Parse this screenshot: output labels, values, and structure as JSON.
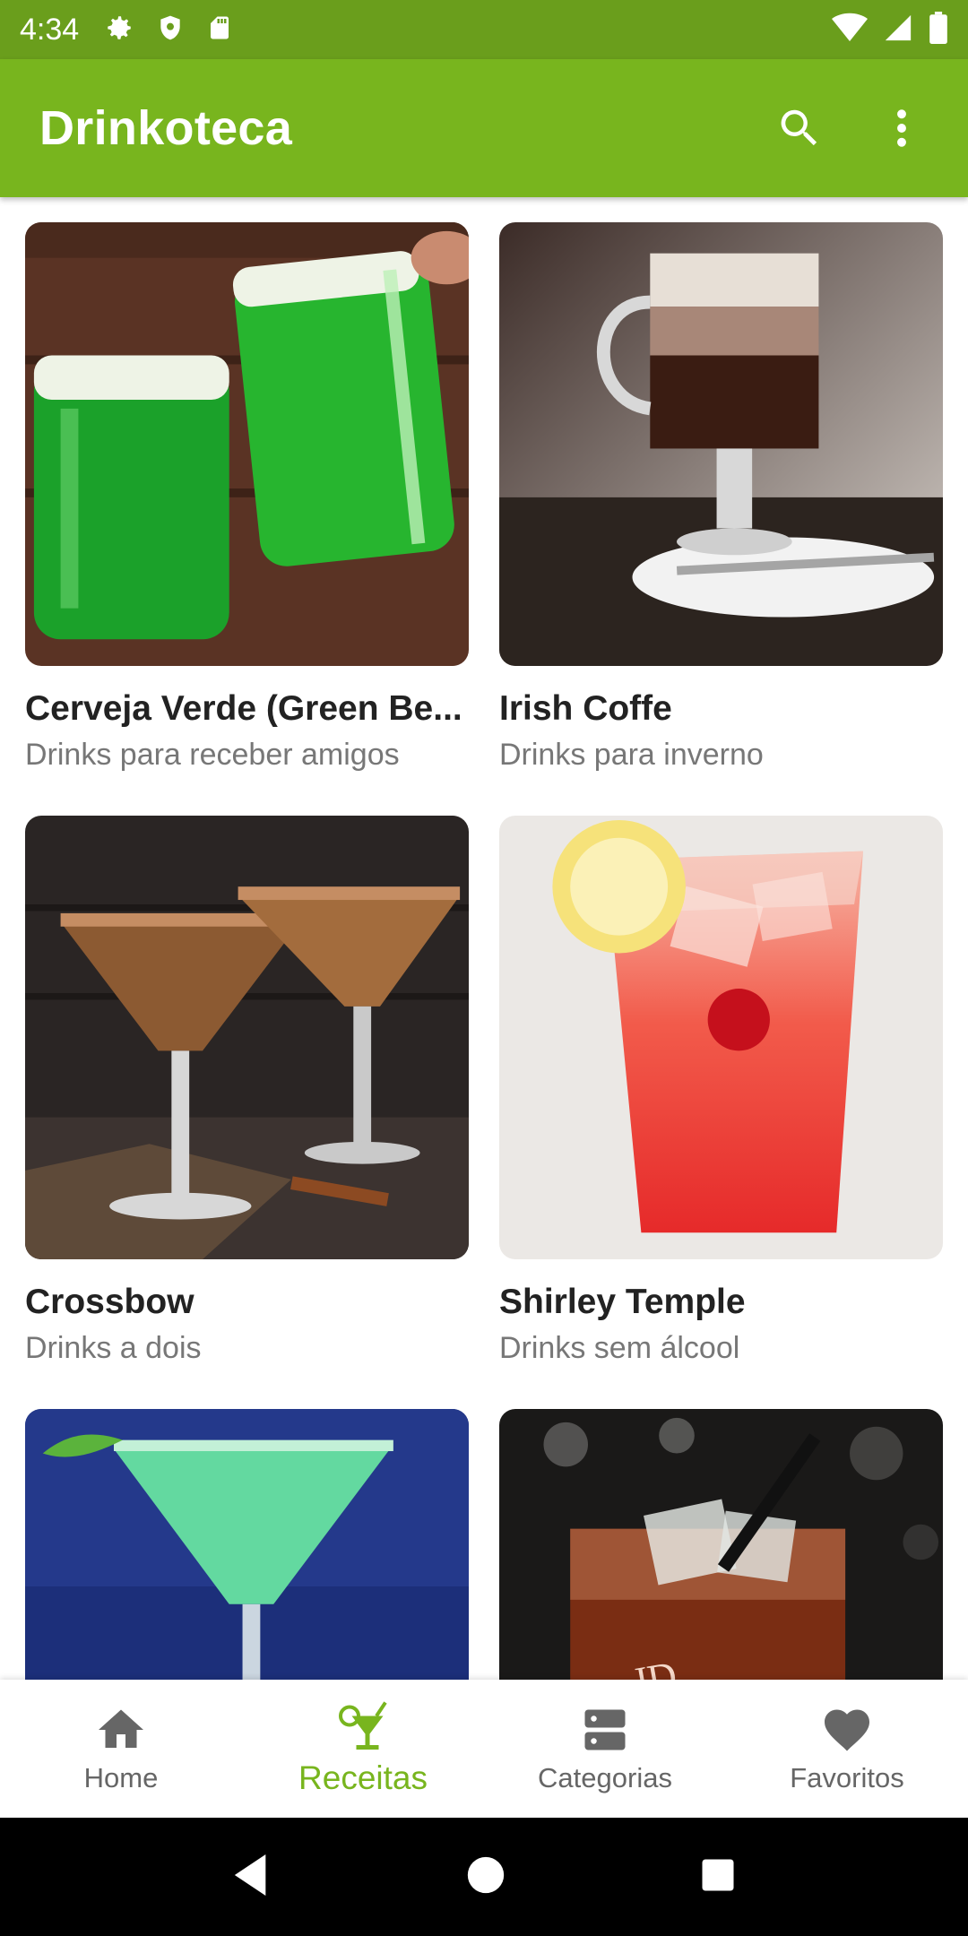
{
  "status_bar": {
    "time": "4:34",
    "left_icons": [
      "gear-icon",
      "shield-icon",
      "sd-card-icon"
    ],
    "right_icons": [
      "wifi-icon",
      "signal-icon",
      "battery-icon"
    ]
  },
  "app_bar": {
    "title": "Drinkoteca",
    "color": "#78b51e",
    "actions": [
      "search-icon",
      "more-vert-icon"
    ]
  },
  "drinks": [
    {
      "title": "Cerveja Verde (Green Be...",
      "category": "Drinks para receber amigos"
    },
    {
      "title": "Irish Coffe",
      "category": "Drinks para inverno"
    },
    {
      "title": "Crossbow",
      "category": "Drinks a dois"
    },
    {
      "title": "Shirley Temple",
      "category": "Drinks sem álcool"
    },
    {
      "title": "",
      "category": ""
    },
    {
      "title": "",
      "category": ""
    }
  ],
  "bottom_nav": {
    "items": [
      {
        "label": "Home",
        "icon": "home-icon",
        "active": false
      },
      {
        "label": "Receitas",
        "icon": "cocktail-icon",
        "active": true
      },
      {
        "label": "Categorias",
        "icon": "categories-icon",
        "active": false
      },
      {
        "label": "Favoritos",
        "icon": "heart-icon",
        "active": false
      }
    ]
  },
  "system_nav": [
    "back-icon",
    "home-circle-icon",
    "recents-icon"
  ]
}
